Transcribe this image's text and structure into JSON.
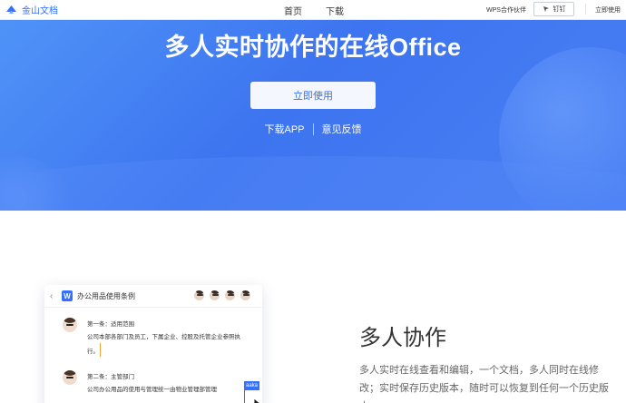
{
  "nav": {
    "logo_text": "金山文档",
    "home": "首页",
    "download": "下载",
    "partner": "WPS合作伙伴",
    "dingding": "钉钉",
    "use_now": "立即使用"
  },
  "hero": {
    "title": "多人实时协作的在线Office",
    "cta": "立即使用",
    "download_app": "下载APP",
    "feedback": "意见反馈"
  },
  "doc_card": {
    "title": "办公用品使用条例",
    "entries": [
      {
        "heading": "第一条：适用范围",
        "body": "公司本部各部门及员工，下属企业、控股及托管企业参照执行。"
      },
      {
        "heading": "第二条：主管部门",
        "body": "公司办公用品的使用与管理统一由物业管理部管理"
      }
    ],
    "collaborator_tag": "aaka"
  },
  "feature": {
    "title": "多人协作",
    "description": "多人实时在线查看和编辑，一个文档，多人同时在线修改；实时保存历史版本，随时可以恢复到任何一个历史版本"
  },
  "colors": {
    "brand": "#3370ff",
    "hero_gradient_start": "#4f93f7",
    "hero_gradient_end": "#3d74f0"
  }
}
